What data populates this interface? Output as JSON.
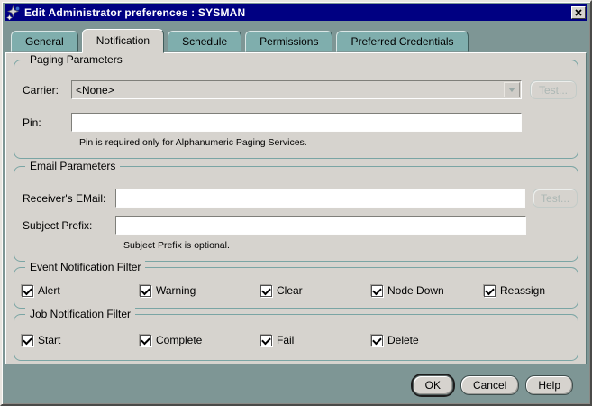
{
  "window": {
    "title": "Edit Administrator preferences : SYSMAN"
  },
  "tabs": [
    {
      "label": "General",
      "active": false
    },
    {
      "label": "Notification",
      "active": true
    },
    {
      "label": "Schedule",
      "active": false
    },
    {
      "label": "Permissions",
      "active": false
    },
    {
      "label": "Preferred Credentials",
      "active": false
    }
  ],
  "paging": {
    "legend": "Paging Parameters",
    "carrier_label": "Carrier:",
    "carrier_value": "<None>",
    "test_label": "Test...",
    "pin_label": "Pin:",
    "pin_value": "",
    "pin_note": "Pin is required only for Alphanumeric Paging Services."
  },
  "email": {
    "legend": "Email Parameters",
    "receiver_label": "Receiver's EMail:",
    "receiver_value": "",
    "test_label": "Test...",
    "subject_label": "Subject Prefix:",
    "subject_value": "",
    "subject_note": "Subject Prefix is optional."
  },
  "event_filter": {
    "legend": "Event Notification Filter",
    "options": [
      {
        "label": "Alert",
        "checked": true
      },
      {
        "label": "Warning",
        "checked": true
      },
      {
        "label": "Clear",
        "checked": true
      },
      {
        "label": "Node Down",
        "checked": true
      },
      {
        "label": "Reassign",
        "checked": true
      }
    ]
  },
  "job_filter": {
    "legend": "Job Notification Filter",
    "options": [
      {
        "label": "Start",
        "checked": true
      },
      {
        "label": "Complete",
        "checked": true
      },
      {
        "label": "Fail",
        "checked": true
      },
      {
        "label": "Delete",
        "checked": true
      }
    ]
  },
  "footer": {
    "ok": "OK",
    "cancel": "Cancel",
    "help": "Help"
  },
  "colors": {
    "titlebar": "#000082",
    "frame": "#7E9695",
    "tab_inactive": "#7FAEAD",
    "surface": "#D6D3CE",
    "group_border": "#7AA5A4"
  }
}
